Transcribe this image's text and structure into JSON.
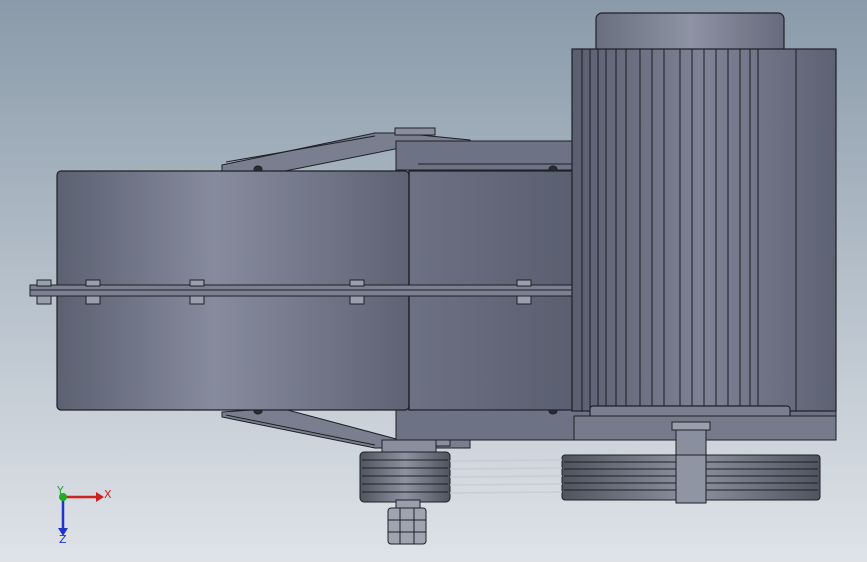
{
  "viewport": {
    "background_top": "#8a9aa9",
    "background_bottom": "#dfe3e8",
    "body_color": "#6a6f80",
    "edge_color": "#1e2026"
  },
  "triad": {
    "x_label": "X",
    "y_label": "Y",
    "z_label": "Z",
    "x_color": "#cc2222",
    "y_color": "#22aa22",
    "z_color": "#2233cc"
  }
}
